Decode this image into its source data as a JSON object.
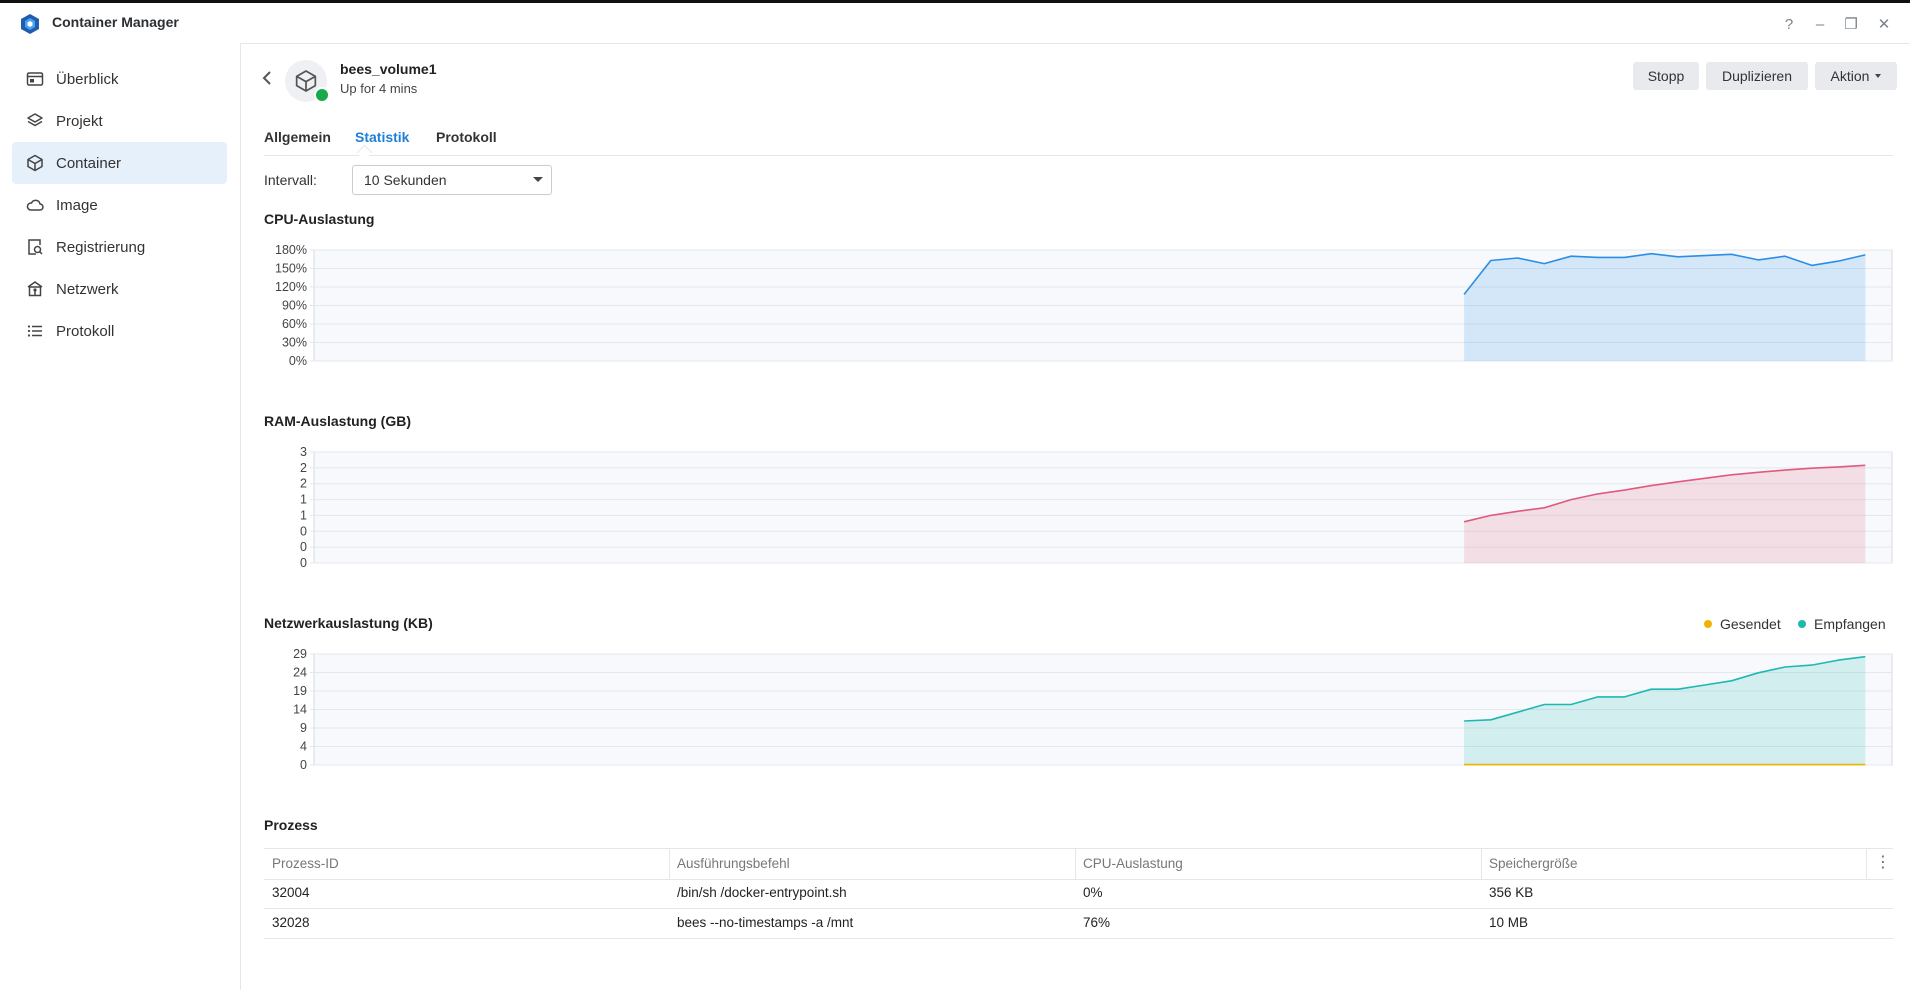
{
  "app": {
    "title": "Container Manager"
  },
  "window_controls": {
    "help": "?",
    "minimize": "–",
    "restore": "❐",
    "close": "✕"
  },
  "sidebar": {
    "items": [
      {
        "label": "Überblick",
        "icon": "overview-icon"
      },
      {
        "label": "Projekt",
        "icon": "project-icon"
      },
      {
        "label": "Container",
        "icon": "container-icon",
        "active": true
      },
      {
        "label": "Image",
        "icon": "image-cloud-icon"
      },
      {
        "label": "Registrierung",
        "icon": "registry-icon"
      },
      {
        "label": "Netzwerk",
        "icon": "network-icon"
      },
      {
        "label": "Protokoll",
        "icon": "log-list-icon"
      }
    ]
  },
  "header": {
    "name": "bees_volume1",
    "status": "Up for 4 mins",
    "status_color": "#1aa84c",
    "buttons": {
      "stop": "Stopp",
      "duplicate": "Duplizieren",
      "action": "Aktion"
    }
  },
  "tabs": {
    "general": "Allgemein",
    "stats": "Statistik",
    "log": "Protokoll",
    "active": "Statistik"
  },
  "interval": {
    "label": "Intervall:",
    "value": "10 Sekunden"
  },
  "sections": {
    "cpu": "CPU-Auslastung",
    "ram": "RAM-Auslastung (GB)",
    "net": "Netzwerkauslastung (KB)",
    "process": "Prozess"
  },
  "legend": {
    "sent": "Gesendet",
    "received": "Empfangen"
  },
  "colors": {
    "cpu": "#2b8ee6",
    "ram": "#e05a7e",
    "received": "#1fb8b0",
    "sent": "#f0b400",
    "accent": "#1f7fd6"
  },
  "chart_data": [
    {
      "type": "area",
      "title": "CPU-Auslastung",
      "y_ticks": [
        "0%",
        "30%",
        "60%",
        "90%",
        "120%",
        "150%",
        "180%"
      ],
      "ylim": [
        0,
        180
      ],
      "x_slots": 60,
      "series": [
        {
          "start_slot": 43,
          "values": [
            108,
            163,
            167,
            158,
            170,
            168,
            168,
            174,
            169,
            171,
            173,
            164,
            170,
            155,
            162,
            172
          ]
        }
      ]
    },
    {
      "type": "area",
      "title": "RAM-Auslastung (GB)",
      "y_ticks": [
        "0",
        "0",
        "0",
        "1",
        "1",
        "2",
        "2",
        "3"
      ],
      "ylim": [
        0,
        3.5
      ],
      "x_slots": 60,
      "series": [
        {
          "start_slot": 43,
          "values": [
            1.3,
            1.5,
            1.63,
            1.74,
            2.0,
            2.18,
            2.3,
            2.44,
            2.56,
            2.67,
            2.78,
            2.86,
            2.93,
            2.99,
            3.03,
            3.08
          ]
        }
      ]
    },
    {
      "type": "area",
      "title": "Netzwerkauslastung (KB)",
      "y_ticks": [
        "0",
        "4",
        "9",
        "14",
        "19",
        "24",
        "29"
      ],
      "ylim": [
        0,
        29
      ],
      "x_slots": 60,
      "series": [
        {
          "name": "Empfangen",
          "start_slot": 43,
          "values": [
            11.5,
            11.8,
            13.8,
            15.8,
            15.8,
            17.8,
            17.8,
            19.8,
            19.8,
            20.9,
            22.0,
            24.1,
            25.6,
            26.1,
            27.4,
            28.3
          ]
        },
        {
          "name": "Gesendet",
          "start_slot": 43,
          "values": [
            0.1,
            0.1,
            0.1,
            0.1,
            0.1,
            0.1,
            0.1,
            0.1,
            0.1,
            0.1,
            0.1,
            0.1,
            0.1,
            0.1,
            0.1,
            0.1
          ]
        }
      ]
    }
  ],
  "process_table": {
    "headers": [
      "Prozess-ID",
      "Ausführungsbefehl",
      "CPU-Auslastung",
      "Speichergröße"
    ],
    "rows": [
      [
        "32004",
        "/bin/sh /docker-entrypoint.sh",
        "0%",
        "356 KB"
      ],
      [
        "32028",
        "bees --no-timestamps -a /mnt",
        "76%",
        "10 MB"
      ]
    ]
  }
}
